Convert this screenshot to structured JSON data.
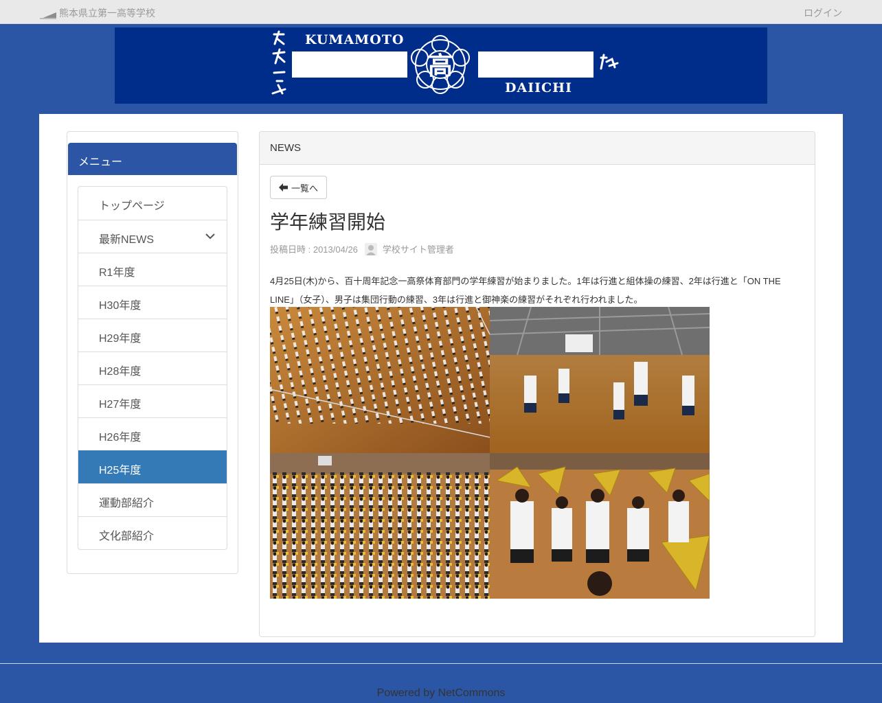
{
  "topbar": {
    "site_name": "熊本県立第一高等学校",
    "login": "ログイン"
  },
  "banner": {
    "text_top": "KUMAMOTO",
    "text_bottom": "DAIICHI",
    "crest_char": "高"
  },
  "menu": {
    "title": "メニュー",
    "items": [
      {
        "label": "トップページ"
      },
      {
        "label": "最新NEWS"
      },
      {
        "label": "R1年度"
      },
      {
        "label": "H30年度"
      },
      {
        "label": "H29年度"
      },
      {
        "label": "H28年度"
      },
      {
        "label": "H27年度"
      },
      {
        "label": "H26年度"
      },
      {
        "label": "H25年度"
      },
      {
        "label": "運動部紹介"
      },
      {
        "label": "文化部紹介"
      }
    ],
    "active_label": "H25年度",
    "expandable_label": "最新NEWS"
  },
  "news": {
    "header": "NEWS",
    "back_label": "一覧へ",
    "title": "学年練習開始",
    "posted_label": "投稿日時 : 2013/04/26",
    "author": "学校サイト管理者",
    "body": "4月25日(木)から、百十周年記念一高祭体育部門の学年練習が始まりました。1年は行進と組体操の練習、2年は行進と「ON THE LINE」（女子）、男子は集団行動の練習、3年は行進と御神楽の練習がそれぞれ行われました。"
  },
  "footer": {
    "powered": "Powered by NetCommons"
  },
  "colors": {
    "background": "#2b56a5",
    "banner": "#002c8a",
    "menu_head": "#2c56a5",
    "active_item": "#337ab7"
  }
}
